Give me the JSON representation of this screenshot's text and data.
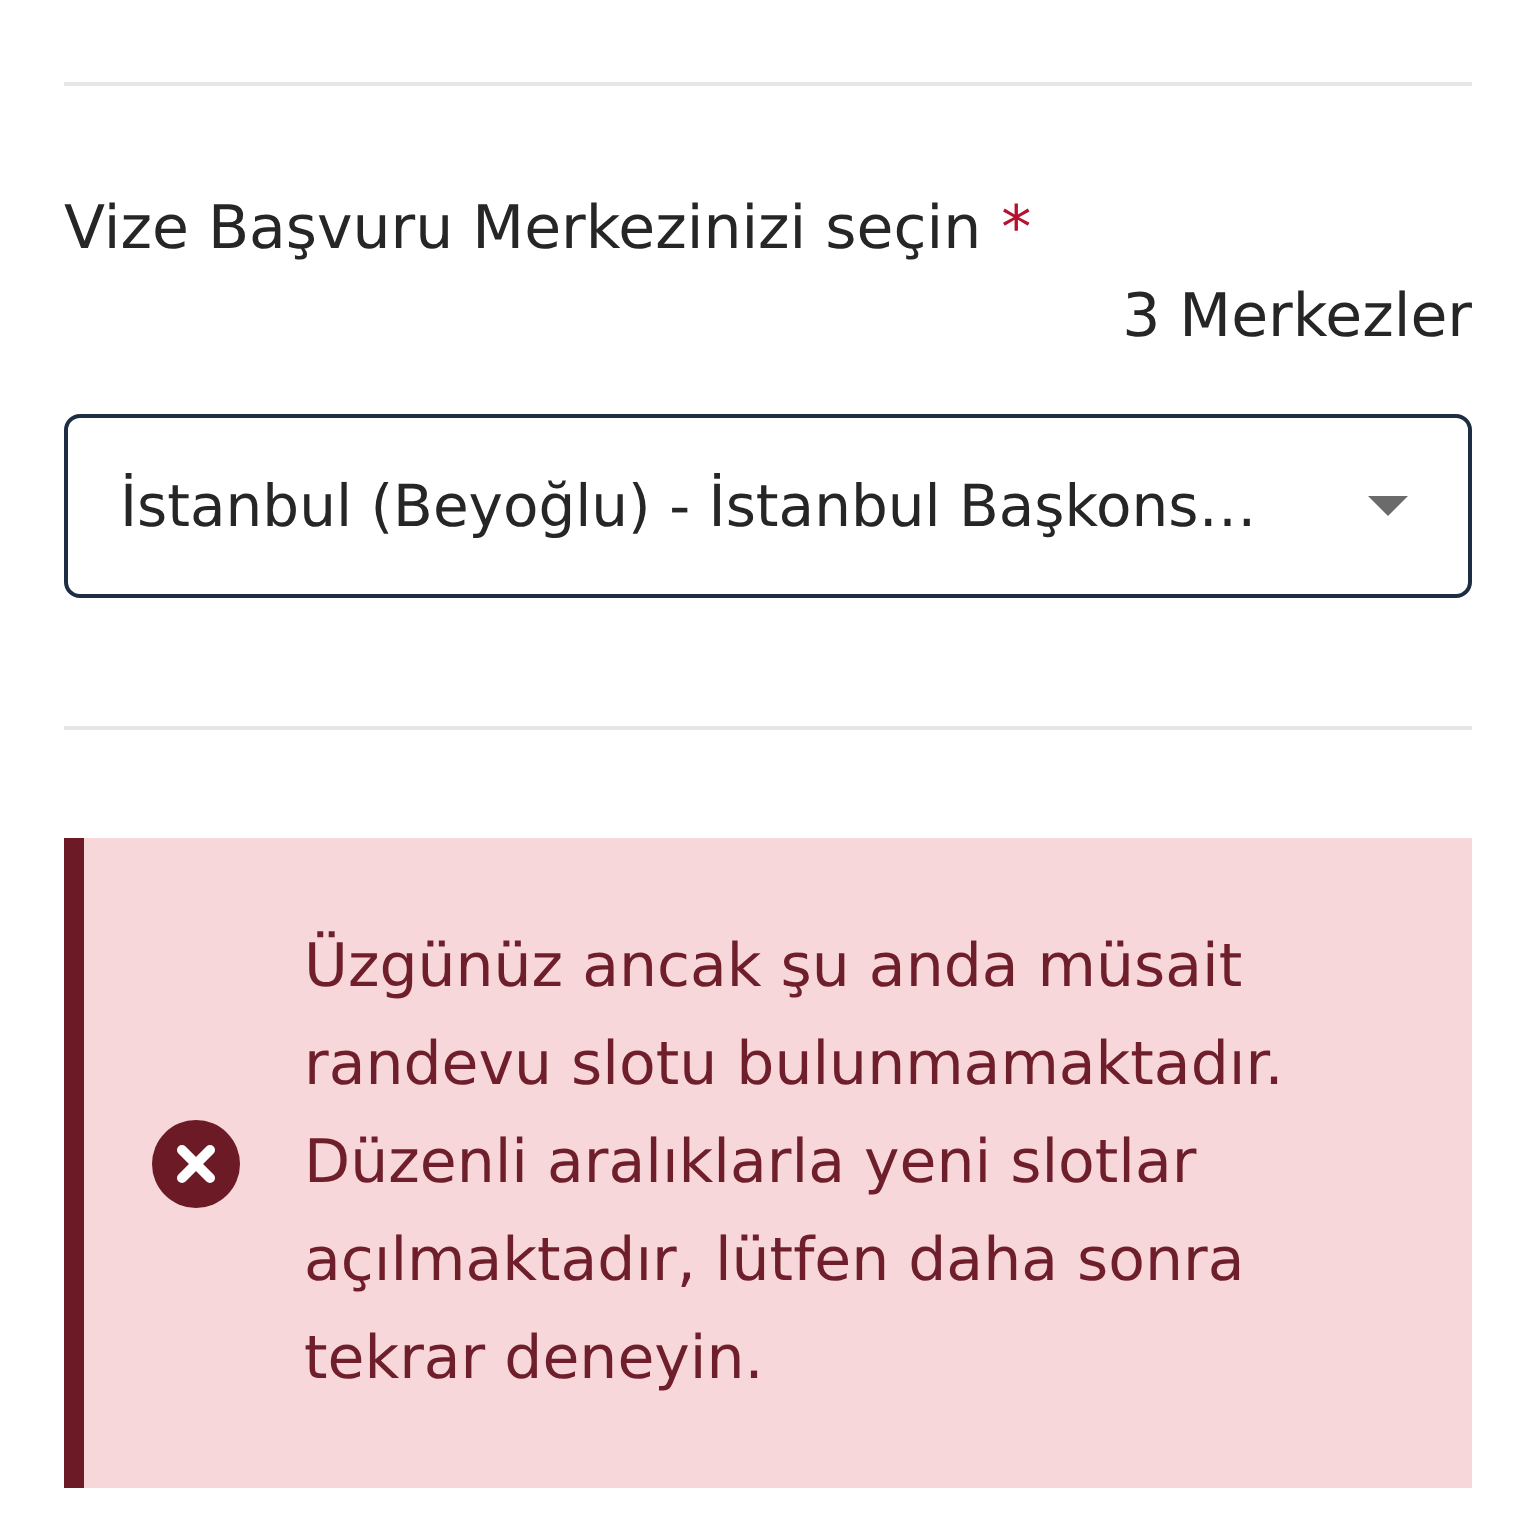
{
  "field": {
    "label": "Vize Başvuru Merkezinizi seçin",
    "required_mark": "*",
    "count": "3 Merkezler",
    "select": {
      "value": "İstanbul (Beyoğlu) - İstanbul Başkons…"
    }
  },
  "alert": {
    "kind": "error",
    "message": "Üzgünüz ancak şu anda müsait randevu slotu bulunmamaktadır. Düzenli aralıklarla yeni slotlar açılmaktadır, lütfen daha sonra tekrar deneyin."
  }
}
